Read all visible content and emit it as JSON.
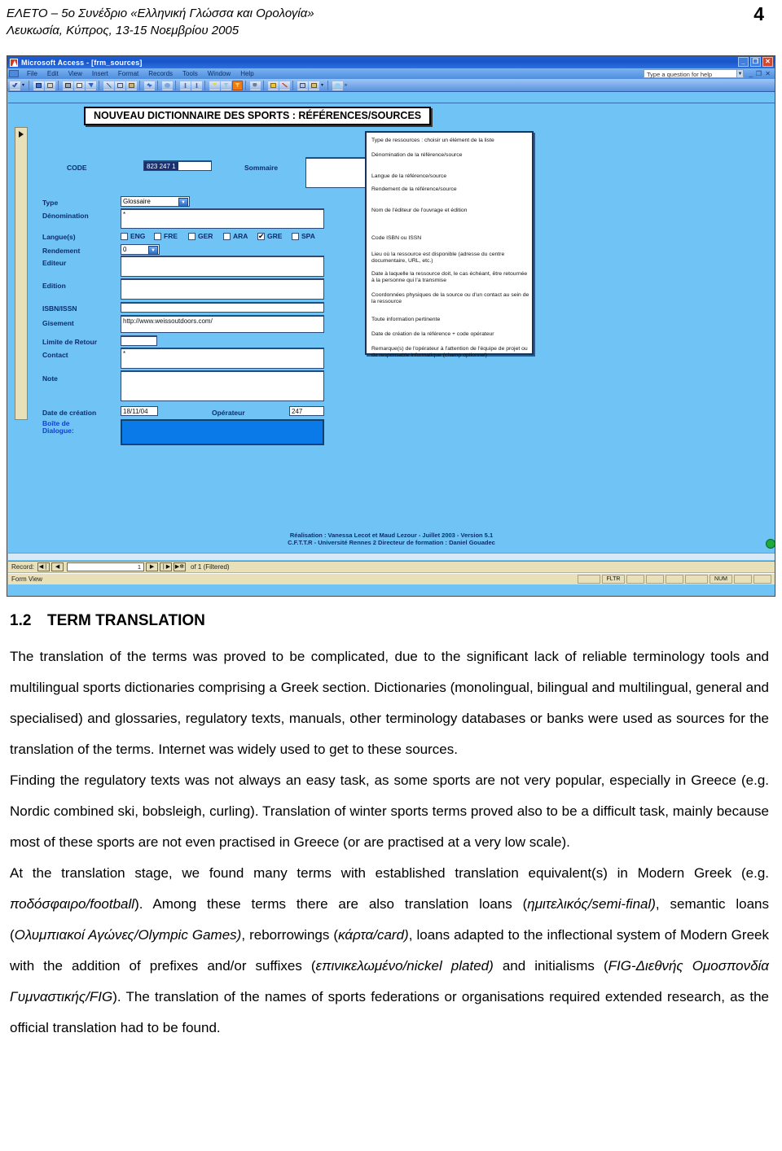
{
  "page_header": {
    "line1": "ΕΛΕΤΟ – 5ο Συνέδριο «Ελληνική Γλώσσα και Ορολογία»",
    "line2": "Λευκωσία, Κύπρος, 13-15 Νοεμβρίου 2005",
    "page_number": "4"
  },
  "window": {
    "title": "Microsoft Access - [frm_sources]",
    "minimize": "_",
    "restore": "❐",
    "close": "✕",
    "doc_minimize": "_",
    "doc_restore": "❐",
    "doc_close": "✕",
    "menus": [
      "File",
      "Edit",
      "View",
      "Insert",
      "Format",
      "Records",
      "Tools",
      "Window",
      "Help"
    ],
    "help_placeholder": "Type a question for help",
    "help_dropdown": "▼"
  },
  "form": {
    "title": "NOUVEAU DICTIONNAIRE DES SPORTS : RÉFÉRENCES/SOURCES",
    "code_label": "CODE",
    "code_value": "823 247 1",
    "sommaire_label": "Sommaire",
    "sommaire_value": "",
    "fields": [
      {
        "label": "Type",
        "value": "Glossaire"
      },
      {
        "label": "Dénomination",
        "value": "*"
      },
      {
        "label": "Langue(s)",
        "value": ""
      },
      {
        "label": "Rendement",
        "value": "0"
      },
      {
        "label": "Editeur",
        "value": ""
      },
      {
        "label": "Edition",
        "value": ""
      },
      {
        "label": "ISBN/ISSN",
        "value": ""
      },
      {
        "label": "Gisement",
        "value": "http://www.weissoutdoors.com/"
      },
      {
        "label": "Limite de Retour",
        "value": ""
      },
      {
        "label": "Contact",
        "value": "*"
      },
      {
        "label": "Note",
        "value": ""
      },
      {
        "label": "Date de création",
        "value": "18/11/04"
      },
      {
        "label": "Boîte de Dialogue:",
        "value": ""
      }
    ],
    "languages": [
      {
        "code": "ENG",
        "checked": false
      },
      {
        "code": "FRE",
        "checked": false
      },
      {
        "code": "GER",
        "checked": false
      },
      {
        "code": "ARA",
        "checked": false
      },
      {
        "code": "GRE",
        "checked": true
      },
      {
        "code": "SPA",
        "checked": false
      }
    ],
    "operator_label": "Opérateur",
    "operator_value": "247",
    "help_panel": [
      "Type de ressources : choisir un élément de la liste",
      "Dénomination de la référence/source",
      "Langue de la référence/source",
      "Rendement de la référence/source",
      "Nom de l'éditeur de l'ouvrage et édition",
      "Code ISBN ou ISSN",
      "Lieu où la ressource est disponible (adresse du centre documentaire, URL, etc.)",
      "Date à laquelle la ressource doit, le cas échéant, être retournée à la personne qui l'a transmise",
      "Coordonnées physiques de la source ou d'un contact au sein de la ressource",
      "Toute information pertinente",
      "Date de création de la référence + code opérateur",
      "Remarque(s) de l'opérateur à l'attention de l'équipe de projet ou du responsable informatique (champ optionnel)"
    ],
    "credit_line1": "Réalisation : Vanessa Lecot et Maud Lezour - Juillet 2003 - Version 5.1",
    "credit_line2": "C.F.T.T.R - Université Rennes 2 Directeur de formation : Daniel Gouadec"
  },
  "navbar": {
    "record_label": "Record:",
    "first": "◀❘",
    "prev": "◀",
    "current": "1",
    "next": "▶",
    "last": "❘▶",
    "new": "▶✻",
    "of_text": "of  1 (Filtered)"
  },
  "statusbar": {
    "text": "Form View",
    "filter": "FLTR",
    "num": "NUM"
  },
  "document": {
    "heading_number": "1.2",
    "heading_text": "TERM TRANSLATION",
    "paragraph1": "The translation of the terms was proved to be complicated, due to the significant lack of reliable terminology tools and multilingual sports dictionaries comprising a Greek section. Dictionaries (monolingual, bilingual and multilingual, general and specialised) and glossaries, regulatory texts, manuals, other terminology databases or banks were used as sources for the translation of the terms. Internet was widely used to get to these sources.",
    "paragraph2_a": "Finding the regulatory texts was not always an easy task, as some sports are not very popular, especially in Greece (e.g. Nordic combined ski, bobsleigh, curling",
    "paragraph2_b": "). Translation of winter sports terms proved also to be a difficult task, mainly because most of these sports are not even practised in Greece (or are practised at a very low scale).",
    "paragraph3_a": "At the translation stage, we found many terms with established translation equivalent(s) in Modern Greek (e.g. ",
    "paragraph3_it1": "ποδόσφαιρο/football",
    "paragraph3_b": "). Among these terms there are also translation loans (",
    "paragraph3_it2": "ημιτελικός/semi-final)",
    "paragraph3_c": ", semantic loans (",
    "paragraph3_it3": "Ολυμπιακοί Αγώνες/Olympic Games)",
    "paragraph3_d": ", reborrowings (",
    "paragraph3_it4": "κάρτα/card)",
    "paragraph3_e": ", loans adapted to the inflectional system of Modern Greek with the addition of prefixes and/or suffixes (",
    "paragraph3_it5": "επινικελωμένο/nickel plated)",
    "paragraph3_f": " and initialisms (",
    "paragraph3_it6": "FIG-Διεθνής Ομοσπονδία Γυμναστικής/FIG",
    "paragraph3_g": "). The translation of the names of sports federations or organisations required extended research, as the official translation had to be found."
  }
}
